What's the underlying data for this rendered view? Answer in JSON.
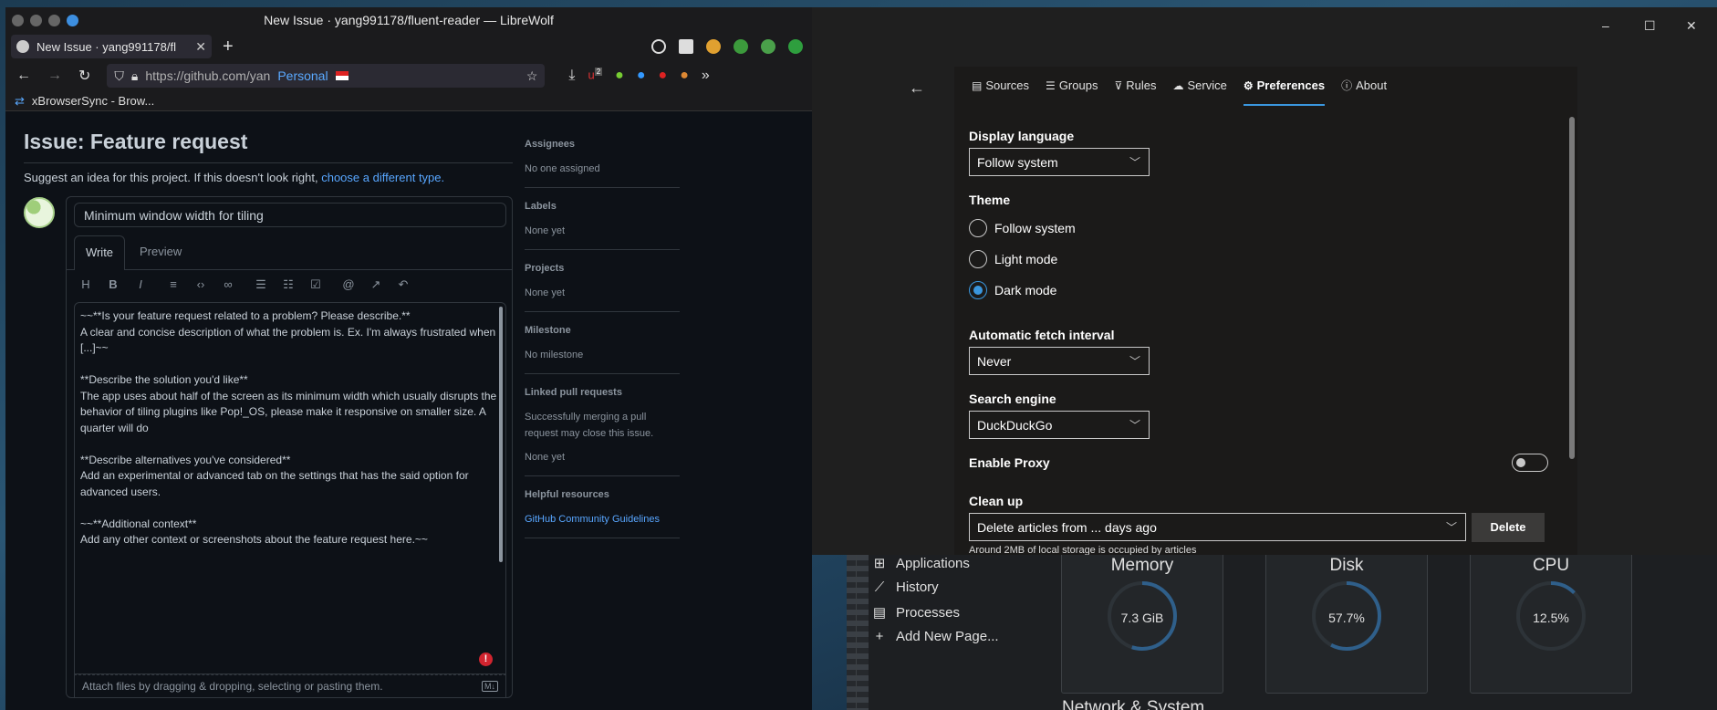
{
  "browser": {
    "window_title": "New Issue · yang991178/fluent-reader — LibreWolf",
    "tab_title": "New Issue · yang991178/fl",
    "tab_close": "✕",
    "new_tab": "+",
    "url": "https://github.com/yan",
    "container": "Personal",
    "bookmark": "xBrowserSync - Brow...",
    "extension_badge": "2"
  },
  "issue": {
    "heading": "Issue: Feature request",
    "suggest_text": "Suggest an idea for this project. If this doesn't look right, ",
    "suggest_link": "choose a different type.",
    "title_value": "Minimum window width for tiling",
    "write_tab": "Write",
    "preview_tab": "Preview",
    "body_lines": [
      "~~**Is your feature request related to a problem? Please describe.**",
      "A clear and concise description of what the problem is. Ex. I'm always frustrated when",
      "[...]~~",
      "",
      "**Describe the solution you'd like**",
      "The app uses about half of the screen as its minimum width which usually disrupts the",
      "behavior of tiling plugins like Pop!_OS, please make it responsive on smaller size. A",
      "quarter will do",
      "",
      "**Describe alternatives you've considered**",
      "Add an experimental or advanced tab on the settings that has the said option for",
      "advanced users.",
      "",
      "~~**Additional context**",
      "Add any other context or screenshots about the feature request here.~~"
    ],
    "attach_text": "Attach files by dragging & dropping, selecting or pasting them.",
    "markdown_badge": "M↓",
    "warning_badge": "!"
  },
  "sidebar": {
    "assignees_label": "Assignees",
    "assignees_value": "No one assigned",
    "labels_label": "Labels",
    "labels_value": "None yet",
    "projects_label": "Projects",
    "projects_value": "None yet",
    "milestone_label": "Milestone",
    "milestone_value": "No milestone",
    "linked_label": "Linked pull requests",
    "linked_help": "Successfully merging a pull request may close this issue.",
    "linked_value": "None yet",
    "helpful_label": "Helpful resources",
    "helpful_link": "GitHub Community Guidelines"
  },
  "fluent": {
    "back_arrow": "←",
    "window_controls": [
      "–",
      "☐",
      "✕"
    ],
    "tabs": [
      "Sources",
      "Groups",
      "Rules",
      "Service",
      "Preferences",
      "About"
    ],
    "active_tab": "Preferences",
    "display_language_label": "Display language",
    "display_language_value": "Follow system",
    "theme_label": "Theme",
    "theme_options": [
      "Follow system",
      "Light mode",
      "Dark mode"
    ],
    "theme_selected": "Dark mode",
    "fetch_label": "Automatic fetch interval",
    "fetch_value": "Never",
    "search_label": "Search engine",
    "search_value": "DuckDuckGo",
    "proxy_label": "Enable Proxy",
    "proxy_enabled": false,
    "cleanup_label": "Clean up",
    "cleanup_value": "Delete articles from ... days ago",
    "delete_button": "Delete",
    "storage_text": "Around 2MB of local storage is occupied by articles",
    "accent": "#3a96dd"
  },
  "sysmon": {
    "nav": [
      "Applications",
      "History",
      "Processes",
      "Add New Page..."
    ],
    "cards": [
      {
        "title": "Memory",
        "value": "7.3 GiB",
        "fraction": 0.55
      },
      {
        "title": "Disk",
        "value": "57.7%",
        "fraction": 0.577
      },
      {
        "title": "CPU",
        "value": "12.5%",
        "fraction": 0.125
      }
    ],
    "section_title": "Network & System"
  }
}
